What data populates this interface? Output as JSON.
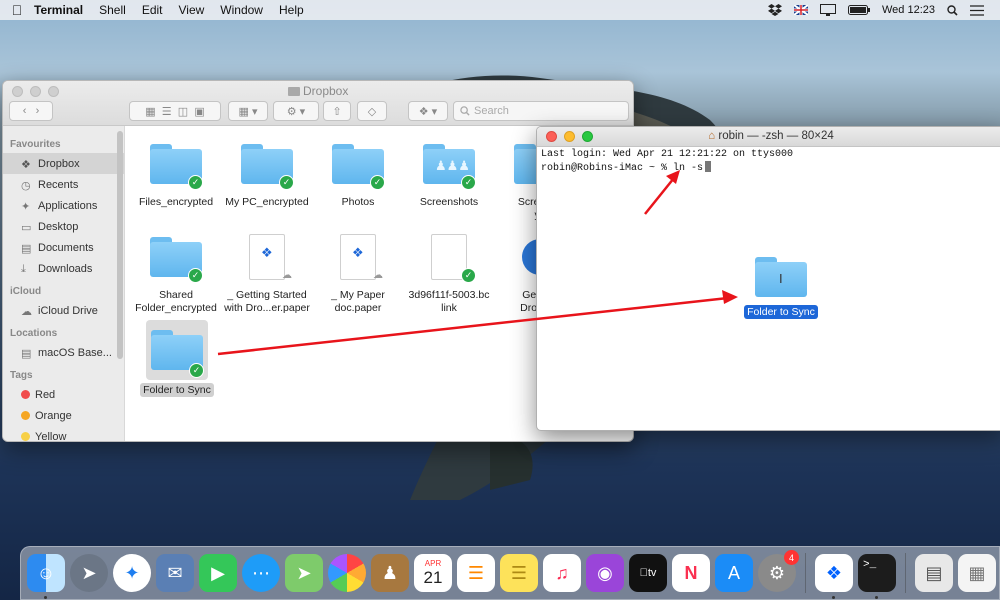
{
  "menubar": {
    "app": "Terminal",
    "items": [
      "Shell",
      "Edit",
      "View",
      "Window",
      "Help"
    ],
    "clock": "Wed 12:23"
  },
  "finder": {
    "title": "Dropbox",
    "search_placeholder": "Search",
    "sidebar": {
      "favourites_head": "Favourites",
      "favourites": [
        "Dropbox",
        "Recents",
        "Applications",
        "Desktop",
        "Documents",
        "Downloads"
      ],
      "icloud_head": "iCloud",
      "icloud": [
        "iCloud Drive"
      ],
      "locations_head": "Locations",
      "locations": [
        "macOS Base..."
      ],
      "tags_head": "Tags",
      "tags": [
        {
          "label": "Red",
          "color": "#f04b4b"
        },
        {
          "label": "Orange",
          "color": "#f5a623"
        },
        {
          "label": "Yellow",
          "color": "#f7d046"
        }
      ]
    },
    "files": [
      {
        "line1": "Files_encrypted",
        "line2": ""
      },
      {
        "line1": "My PC_encrypted",
        "line2": ""
      },
      {
        "line1": "Photos",
        "line2": ""
      },
      {
        "line1": "Screenshots",
        "line2": ""
      },
      {
        "line1": "Screensh",
        "line2": "yp"
      },
      {
        "line1": "Shared",
        "line2": "Folder_encrypted"
      },
      {
        "line1": "_ Getting Started",
        "line2": "with Dro...er.paper"
      },
      {
        "line1": "_ My Paper",
        "line2": "doc.paper"
      },
      {
        "line1": "3d96f11f-5003.bc",
        "line2": "link"
      },
      {
        "line1": "Get Sta",
        "line2": "Dropbox"
      },
      {
        "line1": "Folder to Sync",
        "line2": ""
      }
    ]
  },
  "terminal": {
    "title": "robin — -zsh — 80×24",
    "line1": "Last login: Wed Apr 21 12:21:22 on ttys000",
    "line2": "robin@Robins-iMac ~ % ln -s"
  },
  "drag_item": {
    "label": "Folder to Sync"
  },
  "dock": {
    "calendar_month": "APR",
    "calendar_day": "21",
    "appletv_label": "tv",
    "sysprefs_badge": "4"
  },
  "colors": {
    "folder": "#6dbdf0",
    "sync_check": "#2aa84a",
    "arrow": "#e8141b",
    "selection": "#1d67d8"
  }
}
